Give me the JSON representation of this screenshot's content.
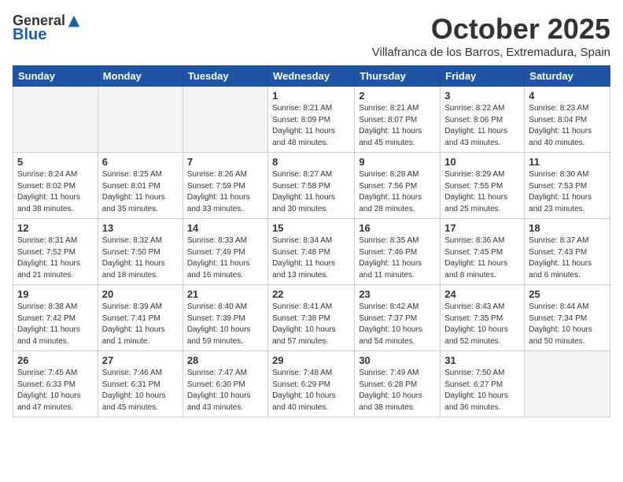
{
  "header": {
    "logo_general": "General",
    "logo_blue": "Blue",
    "month_title": "October 2025",
    "location": "Villafranca de los Barros, Extremadura, Spain"
  },
  "weekdays": [
    "Sunday",
    "Monday",
    "Tuesday",
    "Wednesday",
    "Thursday",
    "Friday",
    "Saturday"
  ],
  "weeks": [
    [
      {
        "day": "",
        "info": ""
      },
      {
        "day": "",
        "info": ""
      },
      {
        "day": "",
        "info": ""
      },
      {
        "day": "1",
        "info": "Sunrise: 8:21 AM\nSunset: 8:09 PM\nDaylight: 11 hours\nand 48 minutes."
      },
      {
        "day": "2",
        "info": "Sunrise: 8:21 AM\nSunset: 8:07 PM\nDaylight: 11 hours\nand 45 minutes."
      },
      {
        "day": "3",
        "info": "Sunrise: 8:22 AM\nSunset: 8:06 PM\nDaylight: 11 hours\nand 43 minutes."
      },
      {
        "day": "4",
        "info": "Sunrise: 8:23 AM\nSunset: 8:04 PM\nDaylight: 11 hours\nand 40 minutes."
      }
    ],
    [
      {
        "day": "5",
        "info": "Sunrise: 8:24 AM\nSunset: 8:02 PM\nDaylight: 11 hours\nand 38 minutes."
      },
      {
        "day": "6",
        "info": "Sunrise: 8:25 AM\nSunset: 8:01 PM\nDaylight: 11 hours\nand 35 minutes."
      },
      {
        "day": "7",
        "info": "Sunrise: 8:26 AM\nSunset: 7:59 PM\nDaylight: 11 hours\nand 33 minutes."
      },
      {
        "day": "8",
        "info": "Sunrise: 8:27 AM\nSunset: 7:58 PM\nDaylight: 11 hours\nand 30 minutes."
      },
      {
        "day": "9",
        "info": "Sunrise: 8:28 AM\nSunset: 7:56 PM\nDaylight: 11 hours\nand 28 minutes."
      },
      {
        "day": "10",
        "info": "Sunrise: 8:29 AM\nSunset: 7:55 PM\nDaylight: 11 hours\nand 25 minutes."
      },
      {
        "day": "11",
        "info": "Sunrise: 8:30 AM\nSunset: 7:53 PM\nDaylight: 11 hours\nand 23 minutes."
      }
    ],
    [
      {
        "day": "12",
        "info": "Sunrise: 8:31 AM\nSunset: 7:52 PM\nDaylight: 11 hours\nand 21 minutes."
      },
      {
        "day": "13",
        "info": "Sunrise: 8:32 AM\nSunset: 7:50 PM\nDaylight: 11 hours\nand 18 minutes."
      },
      {
        "day": "14",
        "info": "Sunrise: 8:33 AM\nSunset: 7:49 PM\nDaylight: 11 hours\nand 16 minutes."
      },
      {
        "day": "15",
        "info": "Sunrise: 8:34 AM\nSunset: 7:48 PM\nDaylight: 11 hours\nand 13 minutes."
      },
      {
        "day": "16",
        "info": "Sunrise: 8:35 AM\nSunset: 7:46 PM\nDaylight: 11 hours\nand 11 minutes."
      },
      {
        "day": "17",
        "info": "Sunrise: 8:36 AM\nSunset: 7:45 PM\nDaylight: 11 hours\nand 8 minutes."
      },
      {
        "day": "18",
        "info": "Sunrise: 8:37 AM\nSunset: 7:43 PM\nDaylight: 11 hours\nand 6 minutes."
      }
    ],
    [
      {
        "day": "19",
        "info": "Sunrise: 8:38 AM\nSunset: 7:42 PM\nDaylight: 11 hours\nand 4 minutes."
      },
      {
        "day": "20",
        "info": "Sunrise: 8:39 AM\nSunset: 7:41 PM\nDaylight: 11 hours\nand 1 minute."
      },
      {
        "day": "21",
        "info": "Sunrise: 8:40 AM\nSunset: 7:39 PM\nDaylight: 10 hours\nand 59 minutes."
      },
      {
        "day": "22",
        "info": "Sunrise: 8:41 AM\nSunset: 7:38 PM\nDaylight: 10 hours\nand 57 minutes."
      },
      {
        "day": "23",
        "info": "Sunrise: 8:42 AM\nSunset: 7:37 PM\nDaylight: 10 hours\nand 54 minutes."
      },
      {
        "day": "24",
        "info": "Sunrise: 8:43 AM\nSunset: 7:35 PM\nDaylight: 10 hours\nand 52 minutes."
      },
      {
        "day": "25",
        "info": "Sunrise: 8:44 AM\nSunset: 7:34 PM\nDaylight: 10 hours\nand 50 minutes."
      }
    ],
    [
      {
        "day": "26",
        "info": "Sunrise: 7:45 AM\nSunset: 6:33 PM\nDaylight: 10 hours\nand 47 minutes."
      },
      {
        "day": "27",
        "info": "Sunrise: 7:46 AM\nSunset: 6:31 PM\nDaylight: 10 hours\nand 45 minutes."
      },
      {
        "day": "28",
        "info": "Sunrise: 7:47 AM\nSunset: 6:30 PM\nDaylight: 10 hours\nand 43 minutes."
      },
      {
        "day": "29",
        "info": "Sunrise: 7:48 AM\nSunset: 6:29 PM\nDaylight: 10 hours\nand 40 minutes."
      },
      {
        "day": "30",
        "info": "Sunrise: 7:49 AM\nSunset: 6:28 PM\nDaylight: 10 hours\nand 38 minutes."
      },
      {
        "day": "31",
        "info": "Sunrise: 7:50 AM\nSunset: 6:27 PM\nDaylight: 10 hours\nand 36 minutes."
      },
      {
        "day": "",
        "info": ""
      }
    ]
  ]
}
